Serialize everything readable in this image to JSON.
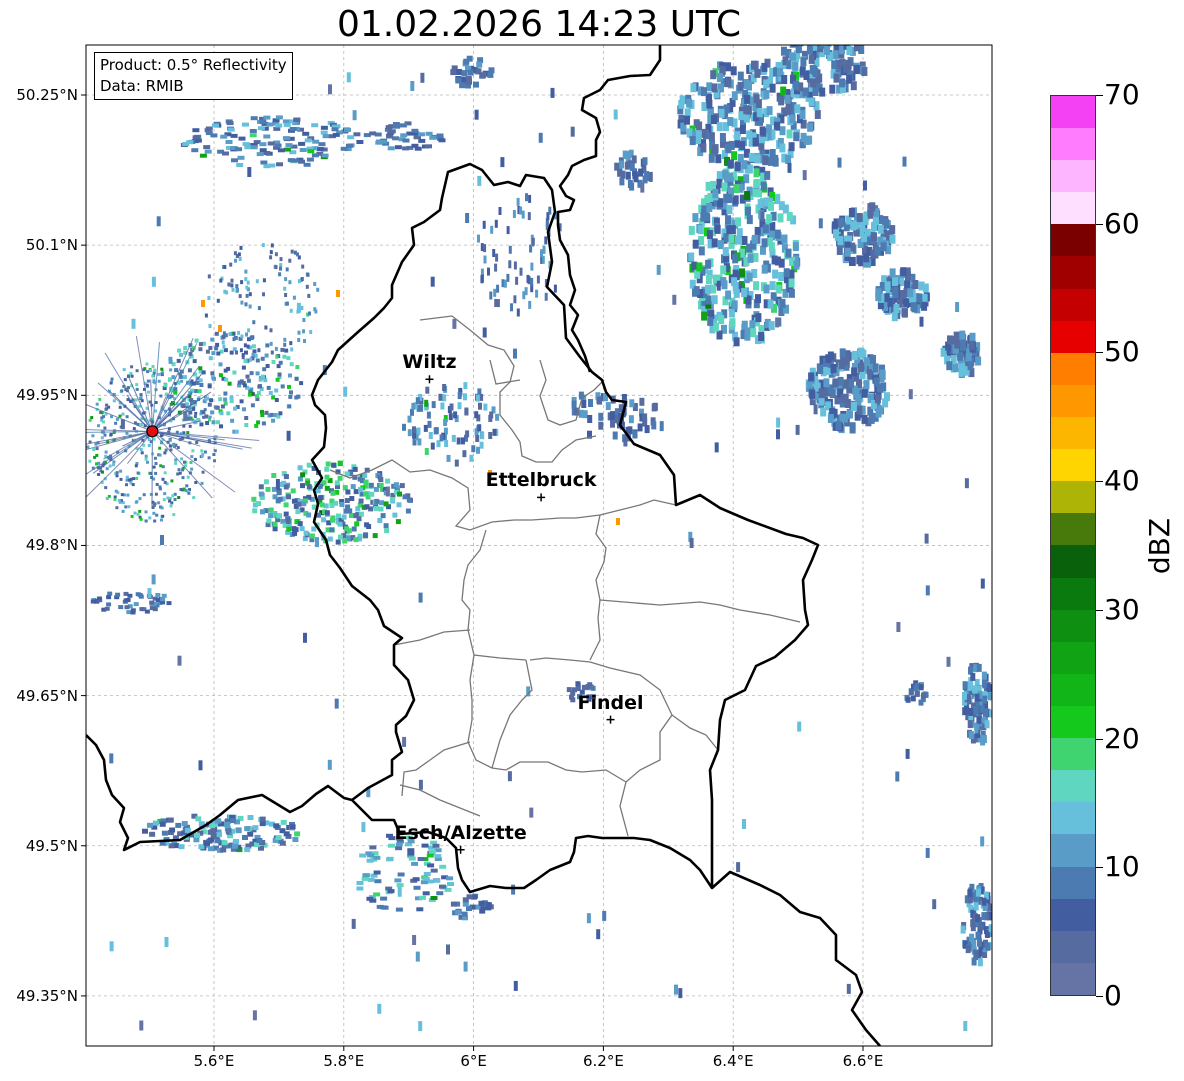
{
  "title": "01.02.2026 14:23 UTC",
  "info": {
    "product": "Product: 0.5° Reflectivity",
    "data_source": "Data: RMIB"
  },
  "lat_labels": [
    "50.25°N",
    "50.1°N",
    "49.95°N",
    "49.8°N",
    "49.65°N",
    "49.5°N",
    "49.35°N"
  ],
  "lon_labels": [
    "5.6°E",
    "5.8°E",
    "6°E",
    "6.2°E",
    "6.4°E",
    "6.6°E"
  ],
  "cities": [
    {
      "name": "Wiltz",
      "lon": 5.932,
      "lat": 49.966
    },
    {
      "name": "Ettelbruck",
      "lon": 6.104,
      "lat": 49.848
    },
    {
      "name": "Findel",
      "lon": 6.211,
      "lat": 49.626
    },
    {
      "name": "Esch/Alzette",
      "lon": 5.98,
      "lat": 49.496
    }
  ],
  "radar_site": {
    "lon": 5.505,
    "lat": 49.914,
    "color": "#e01010"
  },
  "colorbar": {
    "label": "dBZ",
    "ticks": [
      "0",
      "10",
      "20",
      "30",
      "40",
      "50",
      "60",
      "70"
    ],
    "colors": [
      "#6574a5",
      "#566ba0",
      "#435ea0",
      "#4c7bb2",
      "#5a9cc8",
      "#66c0dc",
      "#5fd6c0",
      "#3fd470",
      "#14c81c",
      "#12b518",
      "#10a314",
      "#0f8f12",
      "#0b7a0e",
      "#09620b",
      "#477a0a",
      "#aeb406",
      "#fed500",
      "#fdb600",
      "#ff9800",
      "#ff7e00",
      "#e60000",
      "#c40000",
      "#a00000",
      "#7a0000",
      "#fedfff",
      "#feb5ff",
      "#ff7cff",
      "#f341f3"
    ]
  }
}
